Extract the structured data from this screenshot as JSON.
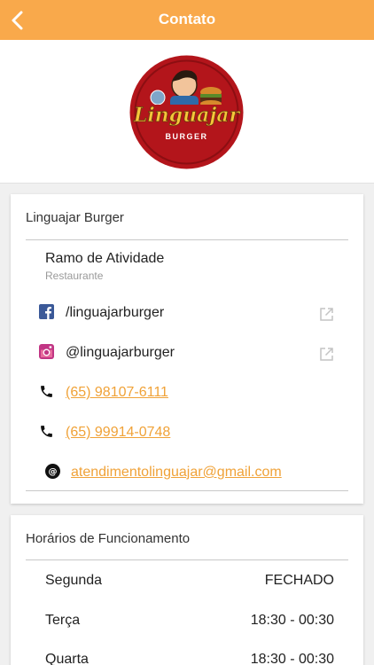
{
  "header": {
    "title": "Contato"
  },
  "business": {
    "name": "Linguajar Burger",
    "ramo_label": "Ramo de Atividade",
    "ramo_value": "Restaurante",
    "logo_text": "Linguajar",
    "logo_sub": "BURGER"
  },
  "contacts": {
    "facebook": "/linguajarburger",
    "instagram": "@linguajarburger",
    "phone1": "(65) 98107-6111",
    "phone2": "(65) 99914-0748",
    "email": "atendimentolinguajar@gmail.com"
  },
  "hours": {
    "title": "Horários de Funcionamento",
    "days": [
      {
        "day": "Segunda",
        "time": "FECHADO"
      },
      {
        "day": "Terça",
        "time": "18:30 - 00:30"
      },
      {
        "day": "Quarta",
        "time": "18:30 - 00:30"
      }
    ]
  },
  "colors": {
    "accent": "#f9a94b",
    "link": "#f0a238",
    "logo_red": "#b3151b"
  }
}
